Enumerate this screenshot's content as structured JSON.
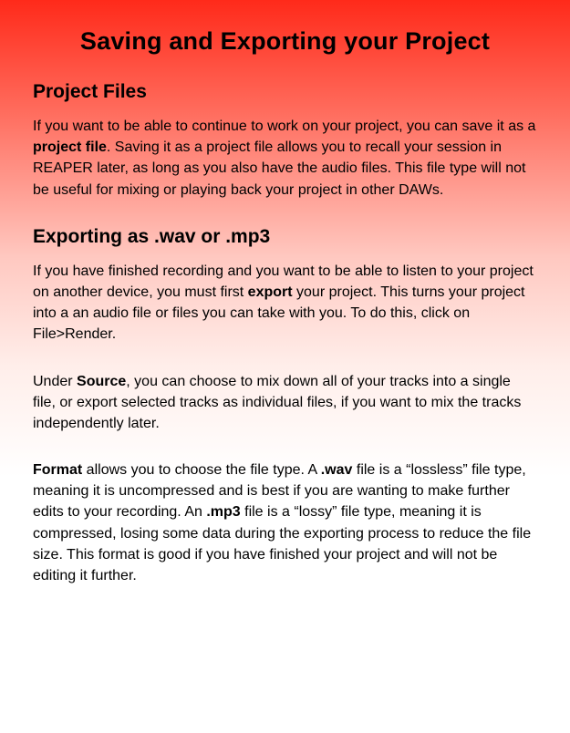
{
  "title": "Saving and Exporting your Project",
  "section1": {
    "heading": "Project Files",
    "p1_a": "If you want to be able to continue to work on your project, you can save it as a ",
    "p1_bold": "project file",
    "p1_b": ". Saving it as a project file allows you to recall your session in REAPER later, as long as you also have the audio files. This file type will not be useful for mixing or playing back your project in other DAWs."
  },
  "section2": {
    "heading": "Exporting as .wav or .mp3",
    "p1_a": "If you have finished recording and you want to be able to listen to your project on another device, you must first ",
    "p1_bold": "export",
    "p1_b": " your project. This turns your project into a an audio file or files you can take with you. To do this, click on File>Render.",
    "p2_a": "Under ",
    "p2_bold": "Source",
    "p2_b": ", you can choose to mix down all of your tracks into a single file, or export selected tracks as individual files, if you want to mix the tracks independently later.",
    "p3_bold1": "Format",
    "p3_a": " allows you to choose the file type. A ",
    "p3_bold2": ".wav",
    "p3_b": " file is a “lossless” file type, meaning it is uncompressed and is best if you are wanting to make further edits to your recording. An ",
    "p3_bold3": ".mp3",
    "p3_c": " file is a “lossy” file type, meaning it is compressed, losing some data during the exporting process to reduce the file size. This format is good if you have finished your project and will not be editing it further."
  }
}
